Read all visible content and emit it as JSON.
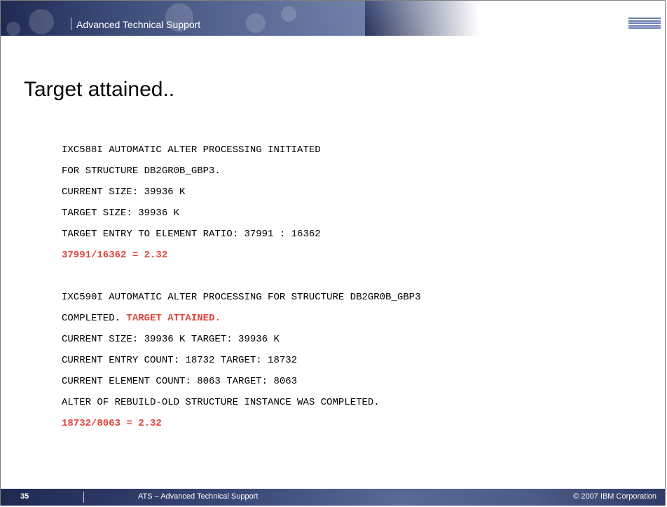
{
  "header": {
    "title": "Advanced Technical Support",
    "logo": "IBM"
  },
  "slide": {
    "title": "Target attained.."
  },
  "console": {
    "block1": [
      "IXC588I AUTOMATIC ALTER PROCESSING INITIATED",
      "FOR STRUCTURE DB2GR0B_GBP3.",
      "CURRENT SIZE: 39936 K",
      "TARGET SIZE: 39936 K",
      "TARGET ENTRY TO ELEMENT RATIO: 37991 : 16362"
    ],
    "calc1": "37991/16362 = 2.32",
    "block2_line1": "IXC590I AUTOMATIC ALTER PROCESSING FOR STRUCTURE DB2GR0B_GBP3",
    "block2_line2_prefix": "COMPLETED. ",
    "block2_line2_highlight": "TARGET ATTAINED.",
    "block2": [
      "CURRENT SIZE: 39936 K TARGET: 39936 K",
      "CURRENT ENTRY COUNT: 18732 TARGET: 18732",
      "CURRENT ELEMENT COUNT: 8063 TARGET: 8063",
      "ALTER OF REBUILD-OLD STRUCTURE INSTANCE WAS COMPLETED."
    ],
    "calc2": "18732/8063 = 2.32"
  },
  "footer": {
    "page_number": "35",
    "text": "ATS – Advanced Technical Support",
    "copyright": "© 2007 IBM Corporation"
  },
  "colors": {
    "highlight": "#e0443a",
    "band": "#28335a"
  }
}
